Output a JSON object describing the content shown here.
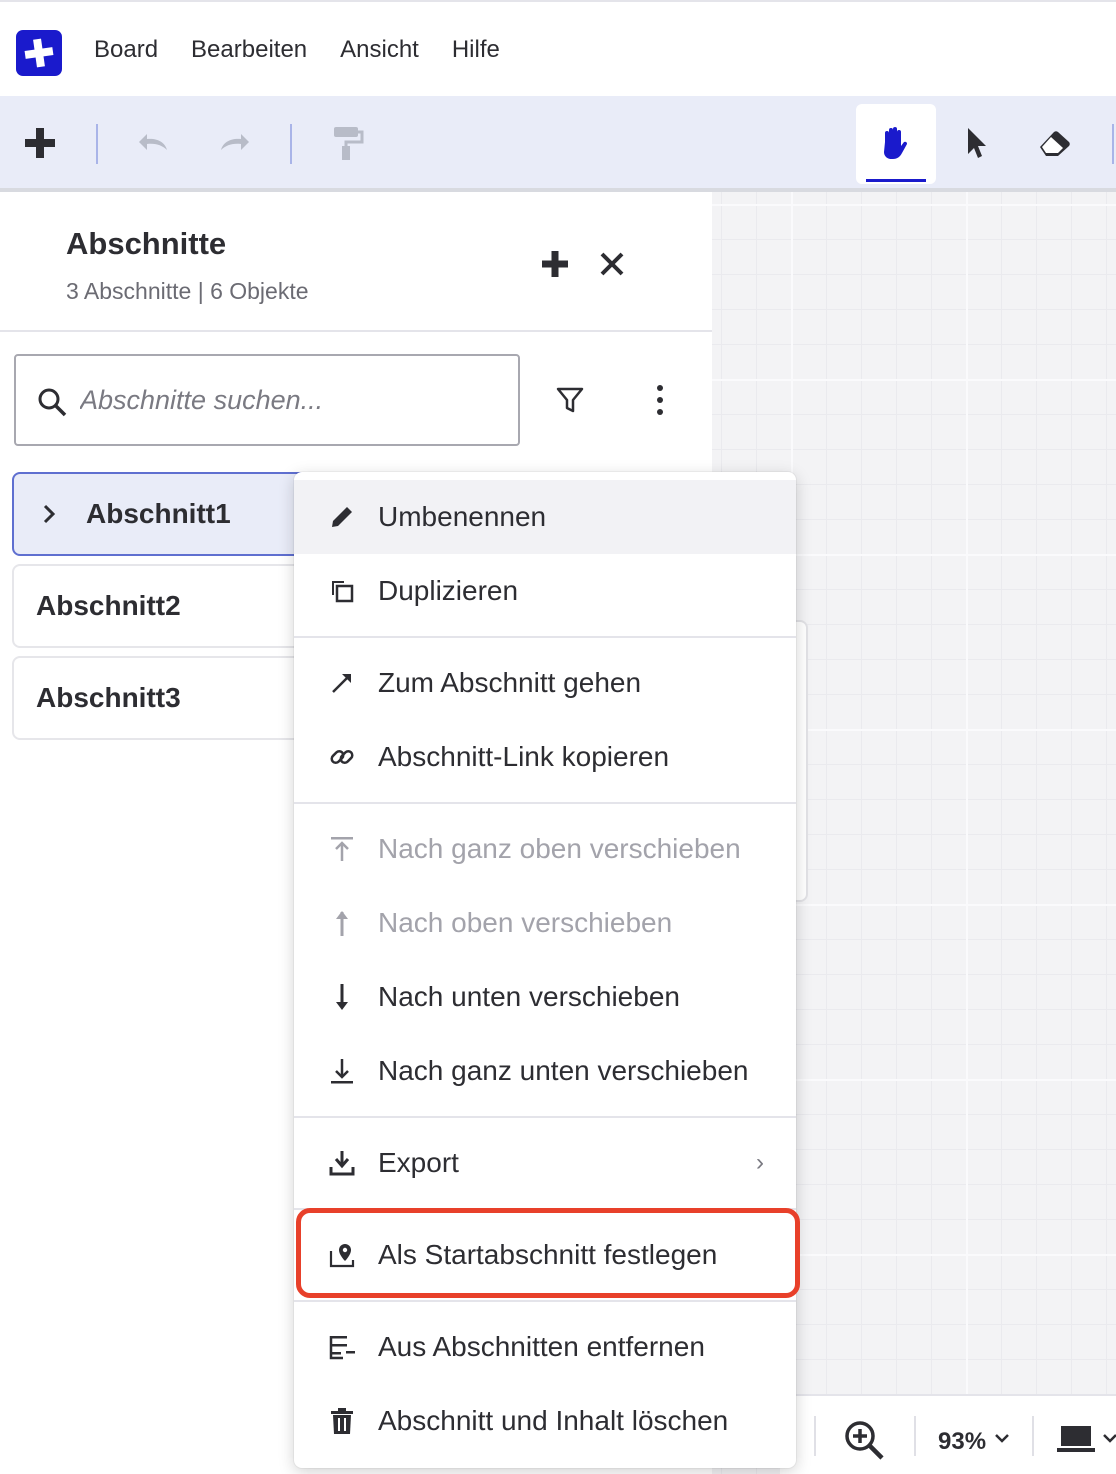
{
  "menubar": {
    "logo": "plus-logo",
    "items": [
      "Board",
      "Bearbeiten",
      "Ansicht",
      "Hilfe"
    ]
  },
  "toolbar": {
    "tools": [
      "add-icon",
      "undo-icon",
      "redo-icon",
      "format-painter-icon",
      "hand-icon",
      "pointer-icon",
      "eraser-icon"
    ],
    "active_tool": "hand-icon",
    "accent_color": "#1a1acc"
  },
  "panel": {
    "title": "Abschnitte",
    "subtitle": "3 Abschnitte | 6 Objekte",
    "search_placeholder": "Abschnitte suchen...",
    "sections": [
      {
        "label": "Abschnitt1",
        "selected": true
      },
      {
        "label": "Abschnitt2",
        "selected": false
      },
      {
        "label": "Abschnitt3",
        "selected": false
      }
    ]
  },
  "context_menu": {
    "items": [
      {
        "label": "Umbenennen",
        "icon": "pencil-icon",
        "state": "hover"
      },
      {
        "label": "Duplizieren",
        "icon": "duplicate-icon"
      },
      {
        "label": "Zum Abschnitt gehen",
        "icon": "arrow-up-right-icon"
      },
      {
        "label": "Abschnitt-Link kopieren",
        "icon": "link-icon"
      },
      {
        "label": "Nach ganz oben verschieben",
        "icon": "move-top-icon",
        "state": "disabled"
      },
      {
        "label": "Nach oben verschieben",
        "icon": "move-up-icon",
        "state": "disabled"
      },
      {
        "label": "Nach unten verschieben",
        "icon": "move-down-icon"
      },
      {
        "label": "Nach ganz unten verschieben",
        "icon": "move-bottom-icon"
      },
      {
        "label": "Export",
        "icon": "download-icon",
        "submenu": "›"
      },
      {
        "label": "Als Startabschnitt festlegen",
        "icon": "start-pin-icon",
        "highlighted": true
      },
      {
        "label": "Aus Abschnitten entfernen",
        "icon": "remove-from-sections-icon"
      },
      {
        "label": "Abschnitt und Inhalt löschen",
        "icon": "trash-icon"
      }
    ],
    "highlight_color": "#e8402a"
  },
  "bottombar": {
    "zoom": "93%"
  }
}
